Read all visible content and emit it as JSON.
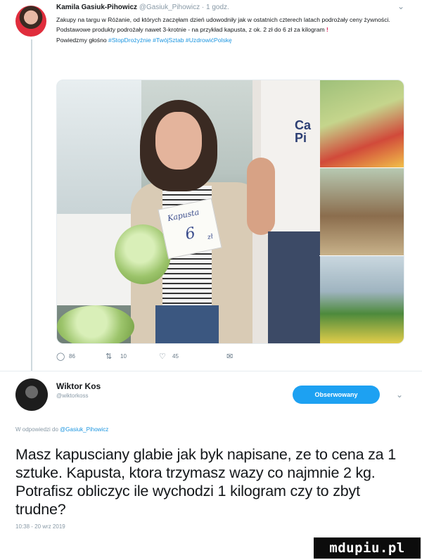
{
  "tweet": {
    "author_name": "Kamila Gasiuk-Pihowicz",
    "author_handle": "@Gasiuk_Pihowicz",
    "separator": "·",
    "age": "1 godz.",
    "text_main": "Zakupy na targu w Różanie, od których zaczęłam dzień udowodniły jak w ostatnich czterech latach podrożały ceny żywności. Podstawowe produkty podrożały nawet 3-krotnie - na przykład kapusta, z ok. 2 zł do 6 zł za kilogram",
    "text_bang": "!",
    "text_line2": "Powiedzmy głośno",
    "hashtags": "#StopDrożyźnie #TwójSztab #UzdrowićPolskę",
    "media": {
      "sign_line1": "Kapusta",
      "sign_price": "6",
      "sign_unit": "zł",
      "shirt_text": "Ca Pi"
    },
    "actions": {
      "reply_icon": "reply-icon",
      "reply_count": "86",
      "retweet_icon": "retweet-icon",
      "retweet_count": "10",
      "like_icon": "heart-icon",
      "like_count": "45",
      "dm_icon": "envelope-icon"
    },
    "chevron": "⌄"
  },
  "reply": {
    "author_name": "Wiktor Kos",
    "author_handle": "@wiktorkoss",
    "follow_label": "Obserwowany",
    "chevron": "⌄",
    "reply_prefix": "W odpowiedzi do",
    "reply_to_handle": "@Gasiuk_Pihowicz",
    "text": "Masz kapusciany glabie jak byk napisane, ze to cena za 1 sztuke. Kapusta, ktora trzymasz wazy co najmnie 2 kg. Potrafisz obliczyc ile wychodzi 1 kilogram czy to zbyt trudne?",
    "timestamp": "10:38 - 20 wrz 2019"
  },
  "watermark": "mdupiu.pl",
  "colors": {
    "link": "#1b95e0",
    "follow_button": "#1da1f2",
    "alert": "#e0245e",
    "muted": "#8899a6"
  }
}
